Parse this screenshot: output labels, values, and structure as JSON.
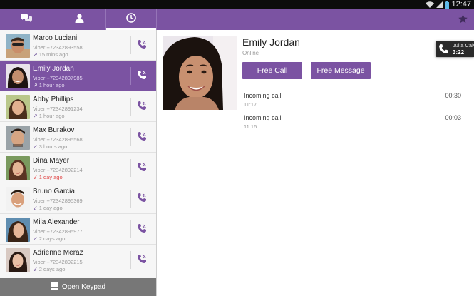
{
  "status_bar": {
    "time": "12:47"
  },
  "tabs": [
    {
      "name": "chats",
      "icon": "chat-bubbles-icon"
    },
    {
      "name": "contacts",
      "icon": "person-icon"
    },
    {
      "name": "recents",
      "icon": "clock-icon",
      "active": true
    },
    {
      "name": "favorites",
      "icon": "star-icon"
    }
  ],
  "calls": [
    {
      "name": "Marco Luciani",
      "number": "Viber +72342893558",
      "time": "15 mins ago",
      "direction": "outgoing",
      "avatar": "avatar-marco"
    },
    {
      "name": "Emily Jordan",
      "number": "Viber +72342897985",
      "time": "1 hour ago",
      "direction": "outgoing",
      "selected": true,
      "avatar": "avatar-emily"
    },
    {
      "name": "Abby Phillips",
      "number": "Viber +72342891234",
      "time": "1 hour ago",
      "direction": "outgoing",
      "avatar": "avatar-abby"
    },
    {
      "name": "Max Burakov",
      "number": "Viber +72342895568",
      "time": "3 hours ago",
      "direction": "incoming",
      "avatar": "avatar-max"
    },
    {
      "name": "Dina Mayer",
      "number": "Viber +72342892214",
      "time": "1 day ago",
      "direction": "missed",
      "avatar": "avatar-dina"
    },
    {
      "name": "Bruno Garcia",
      "number": "Viber +72342895369",
      "time": "1 day ago",
      "direction": "incoming",
      "avatar": "avatar-bruno"
    },
    {
      "name": "Mila Alexander",
      "number": "Viber +72342895977",
      "time": "2 days ago",
      "direction": "incoming",
      "avatar": "avatar-mila"
    },
    {
      "name": "Adrienne Meraz",
      "number": "Viber +72342892215",
      "time": "2 days ago",
      "direction": "incoming",
      "avatar": "avatar-adrienne"
    }
  ],
  "keypad": {
    "label": "Open Keypad"
  },
  "detail": {
    "name": "Emily Jordan",
    "status": "Online",
    "free_call_label": "Free Call",
    "free_message_label": "Free Message",
    "log": [
      {
        "type": "Incoming call",
        "time": "11:17",
        "duration": "00:30"
      },
      {
        "type": "Incoming call",
        "time": "11:16",
        "duration": "00:03"
      }
    ]
  },
  "ongoing_call": {
    "name": "Julia Calv",
    "timer": "3:22"
  },
  "colors": {
    "brand": "#7b53a2",
    "missed": "#e04848",
    "keypad_bar": "#777777"
  }
}
